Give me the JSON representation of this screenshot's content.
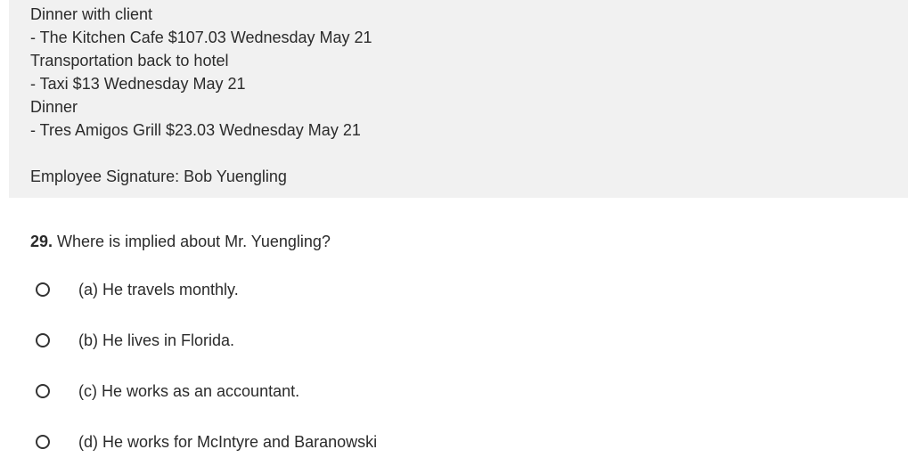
{
  "passage": {
    "lines": [
      "Dinner with client",
      "- The Kitchen Cafe $107.03 Wednesday May 21",
      "Transportation back to hotel",
      "- Taxi $13 Wednesday May 21",
      "Dinner",
      "- Tres Amigos Grill $23.03 Wednesday May 21"
    ],
    "signature": "Employee Signature: Bob Yuengling"
  },
  "question": {
    "number": "29.",
    "text": "Where is implied about Mr. Yuengling?",
    "options": [
      {
        "label": "(a) He travels monthly.",
        "selected": false
      },
      {
        "label": "(b) He lives in Florida.",
        "selected": false
      },
      {
        "label": "(c) He works as an accountant.",
        "selected": false
      },
      {
        "label": "(d) He works for McIntyre and Baranowski",
        "selected": false
      }
    ]
  }
}
